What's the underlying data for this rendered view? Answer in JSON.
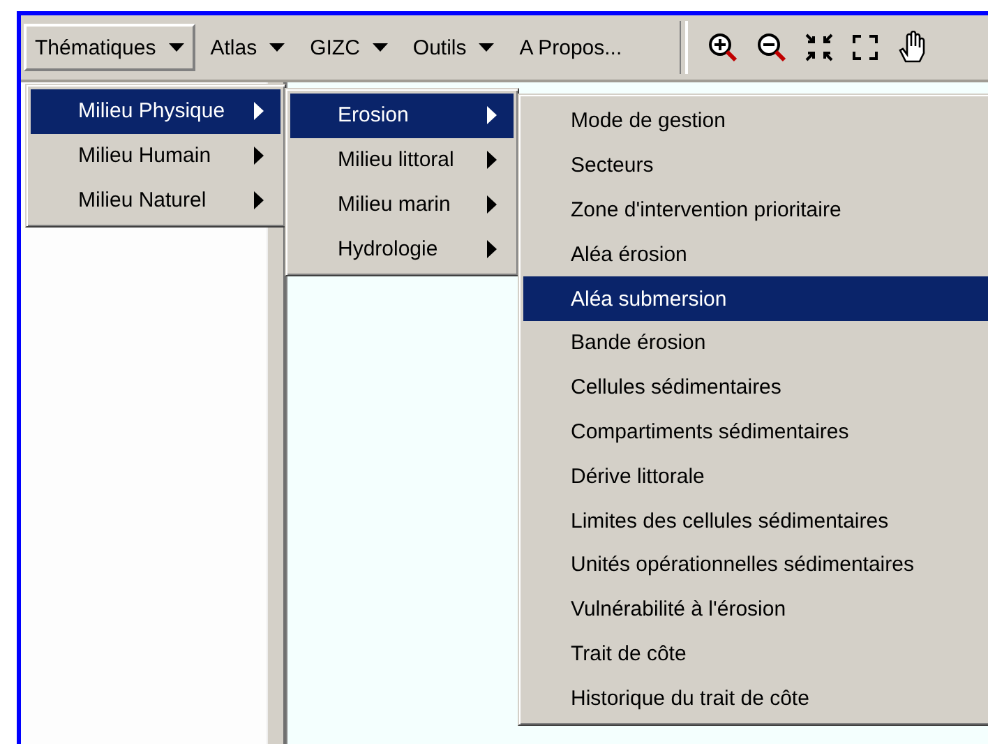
{
  "menubar": [
    {
      "label": "Thématiques",
      "dropdown": true,
      "selected": true
    },
    {
      "label": "Atlas",
      "dropdown": true,
      "selected": false
    },
    {
      "label": "GIZC",
      "dropdown": true,
      "selected": false
    },
    {
      "label": "Outils",
      "dropdown": true,
      "selected": false
    },
    {
      "label": "A Propos...",
      "dropdown": false,
      "selected": false
    }
  ],
  "menus": [
    {
      "items": [
        {
          "label": "Milieu Physique",
          "submenu": true,
          "selected": true
        },
        {
          "label": "Milieu Humain",
          "submenu": true,
          "selected": false
        },
        {
          "label": "Milieu Naturel",
          "submenu": true,
          "selected": false
        }
      ]
    },
    {
      "items": [
        {
          "label": "Erosion",
          "submenu": true,
          "selected": true
        },
        {
          "label": "Milieu littoral",
          "submenu": true,
          "selected": false
        },
        {
          "label": "Milieu marin",
          "submenu": true,
          "selected": false
        },
        {
          "label": "Hydrologie",
          "submenu": true,
          "selected": false
        }
      ]
    },
    {
      "items": [
        {
          "label": "Mode de gestion",
          "submenu": false,
          "selected": false
        },
        {
          "label": "Secteurs",
          "submenu": false,
          "selected": false
        },
        {
          "label": "Zone d'intervention prioritaire",
          "submenu": false,
          "selected": false
        },
        {
          "label": "Aléa érosion",
          "submenu": false,
          "selected": false
        },
        {
          "label": "Aléa submersion",
          "submenu": false,
          "selected": true
        },
        {
          "label": "Bande érosion",
          "submenu": false,
          "selected": false
        },
        {
          "label": "Cellules sédimentaires",
          "submenu": false,
          "selected": false
        },
        {
          "label": "Compartiments sédimentaires",
          "submenu": false,
          "selected": false
        },
        {
          "label": "Dérive littorale",
          "submenu": false,
          "selected": false
        },
        {
          "label": "Limites des cellules sédimentaires",
          "submenu": false,
          "selected": false
        },
        {
          "label": "Unités opérationnelles sédimentaires",
          "submenu": false,
          "selected": false
        },
        {
          "label": "Vulnérabilité à l'érosion",
          "submenu": false,
          "selected": false
        },
        {
          "label": "Trait de côte",
          "submenu": false,
          "selected": false
        },
        {
          "label": "Historique du trait de côte",
          "submenu": false,
          "selected": false
        }
      ]
    }
  ]
}
